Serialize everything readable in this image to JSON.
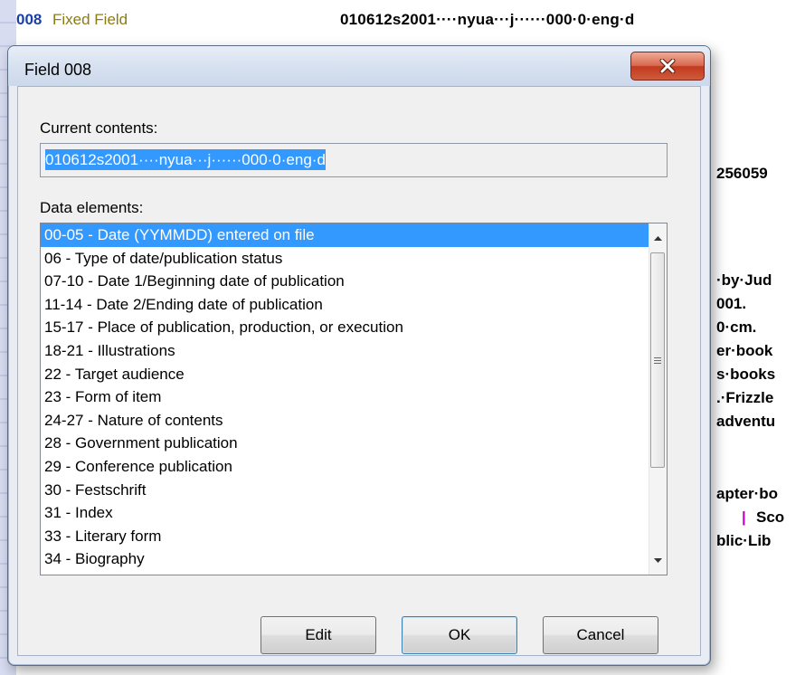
{
  "background": {
    "field_tag": "008",
    "field_name": "Fixed Field",
    "field_value": "010612s2001····nyua···j······000·0·eng·d",
    "fragments": [
      "256059",
      "·by·Jud",
      "001.",
      "0·cm.",
      "er·book",
      "s·books",
      ".·Frizzle",
      "adventu",
      "apter·bo",
      "Sco",
      "blic·Lib"
    ]
  },
  "dialog": {
    "title": "Field 008",
    "current_contents_label": "Current contents:",
    "current_contents_value": "010612s2001····nyua···j······000·0·eng·d",
    "data_elements_label": "Data elements:",
    "data_elements": [
      "00-05 - Date (YYMMDD) entered  on file",
      "06 - Type of date/publication status",
      "07-10 - Date 1/Beginning date of publication",
      "11-14 - Date 2/Ending date of publication",
      "15-17 - Place of publication, production, or execution",
      "18-21 - Illustrations",
      "22 - Target audience",
      "23 - Form of item",
      "24-27 - Nature of contents",
      "28 - Government publication",
      "29 - Conference publication",
      "30 - Festschrift",
      "31 - Index",
      "33 - Literary form",
      "34 - Biography"
    ],
    "selected_index": 0,
    "buttons": {
      "edit": "Edit",
      "ok": "OK",
      "cancel": "Cancel"
    }
  },
  "colors": {
    "selection": "#3399ff",
    "tag": "#1a3fa8",
    "field_name": "#8c7a14",
    "subfield_delimiter": "#c000c0",
    "close_button": "#c23a1e"
  },
  "icons": [
    "close-icon",
    "scroll-up-icon",
    "scroll-down-icon",
    "scroll-grip-icon"
  ]
}
